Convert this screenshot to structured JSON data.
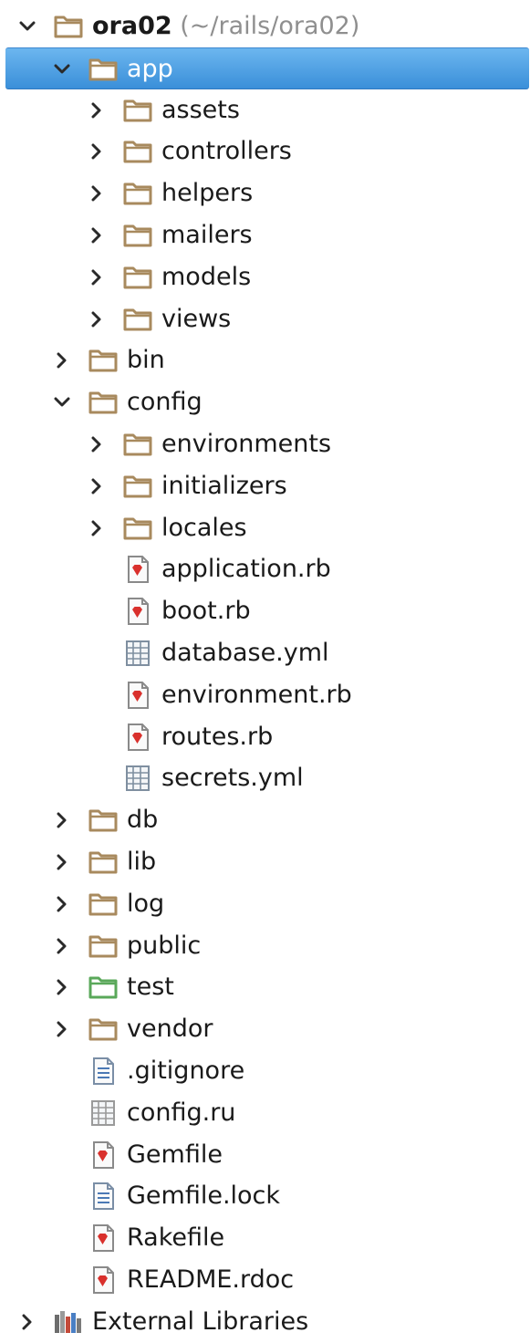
{
  "root": {
    "name": "ora02",
    "path": "(~/rails/ora02)"
  },
  "colors": {
    "folder": "#a88a5e",
    "test_folder": "#5aa85a",
    "ruby_red": "#d9302c",
    "selection": "#4a9de3"
  },
  "items": [
    {
      "label": "ora02",
      "depth": 0,
      "kind": "folder",
      "arrow": "expanded",
      "row": 0,
      "bold": true
    },
    {
      "label": "app",
      "depth": 1,
      "kind": "folder",
      "arrow": "expanded",
      "row": 1,
      "selected": true
    },
    {
      "label": "assets",
      "depth": 2,
      "kind": "folder",
      "arrow": "collapsed",
      "row": 2
    },
    {
      "label": "controllers",
      "depth": 2,
      "kind": "folder",
      "arrow": "collapsed",
      "row": 3
    },
    {
      "label": "helpers",
      "depth": 2,
      "kind": "folder",
      "arrow": "collapsed",
      "row": 4
    },
    {
      "label": "mailers",
      "depth": 2,
      "kind": "folder",
      "arrow": "collapsed",
      "row": 5
    },
    {
      "label": "models",
      "depth": 2,
      "kind": "folder",
      "arrow": "collapsed",
      "row": 6
    },
    {
      "label": "views",
      "depth": 2,
      "kind": "folder",
      "arrow": "collapsed",
      "row": 7
    },
    {
      "label": "bin",
      "depth": 1,
      "kind": "folder",
      "arrow": "collapsed",
      "row": 8
    },
    {
      "label": "config",
      "depth": 1,
      "kind": "folder",
      "arrow": "expanded",
      "row": 9
    },
    {
      "label": "environments",
      "depth": 2,
      "kind": "folder",
      "arrow": "collapsed",
      "row": 10
    },
    {
      "label": "initializers",
      "depth": 2,
      "kind": "folder",
      "arrow": "collapsed",
      "row": 11
    },
    {
      "label": "locales",
      "depth": 2,
      "kind": "folder",
      "arrow": "collapsed",
      "row": 12
    },
    {
      "label": "application.rb",
      "depth": 2,
      "kind": "ruby",
      "row": 13
    },
    {
      "label": "boot.rb",
      "depth": 2,
      "kind": "ruby",
      "row": 14
    },
    {
      "label": "database.yml",
      "depth": 2,
      "kind": "yml",
      "row": 15
    },
    {
      "label": "environment.rb",
      "depth": 2,
      "kind": "ruby",
      "row": 16
    },
    {
      "label": "routes.rb",
      "depth": 2,
      "kind": "ruby",
      "row": 17
    },
    {
      "label": "secrets.yml",
      "depth": 2,
      "kind": "yml",
      "row": 18
    },
    {
      "label": "db",
      "depth": 1,
      "kind": "folder",
      "arrow": "collapsed",
      "row": 19
    },
    {
      "label": "lib",
      "depth": 1,
      "kind": "folder",
      "arrow": "collapsed",
      "row": 20
    },
    {
      "label": "log",
      "depth": 1,
      "kind": "folder",
      "arrow": "collapsed",
      "row": 21
    },
    {
      "label": "public",
      "depth": 1,
      "kind": "folder",
      "arrow": "collapsed",
      "row": 22
    },
    {
      "label": "test",
      "depth": 1,
      "kind": "test-folder",
      "arrow": "collapsed",
      "row": 23
    },
    {
      "label": "vendor",
      "depth": 1,
      "kind": "folder",
      "arrow": "collapsed",
      "row": 24
    },
    {
      "label": ".gitignore",
      "depth": 1,
      "kind": "text",
      "row": 25
    },
    {
      "label": "config.ru",
      "depth": 1,
      "kind": "grid",
      "row": 26
    },
    {
      "label": "Gemfile",
      "depth": 1,
      "kind": "ruby",
      "row": 27
    },
    {
      "label": "Gemfile.lock",
      "depth": 1,
      "kind": "text",
      "row": 28
    },
    {
      "label": "Rakefile",
      "depth": 1,
      "kind": "ruby",
      "row": 29
    },
    {
      "label": "README.rdoc",
      "depth": 1,
      "kind": "ruby",
      "row": 30
    },
    {
      "label": "External Libraries",
      "depth": 0,
      "kind": "library",
      "arrow": "collapsed",
      "row": 31
    }
  ]
}
